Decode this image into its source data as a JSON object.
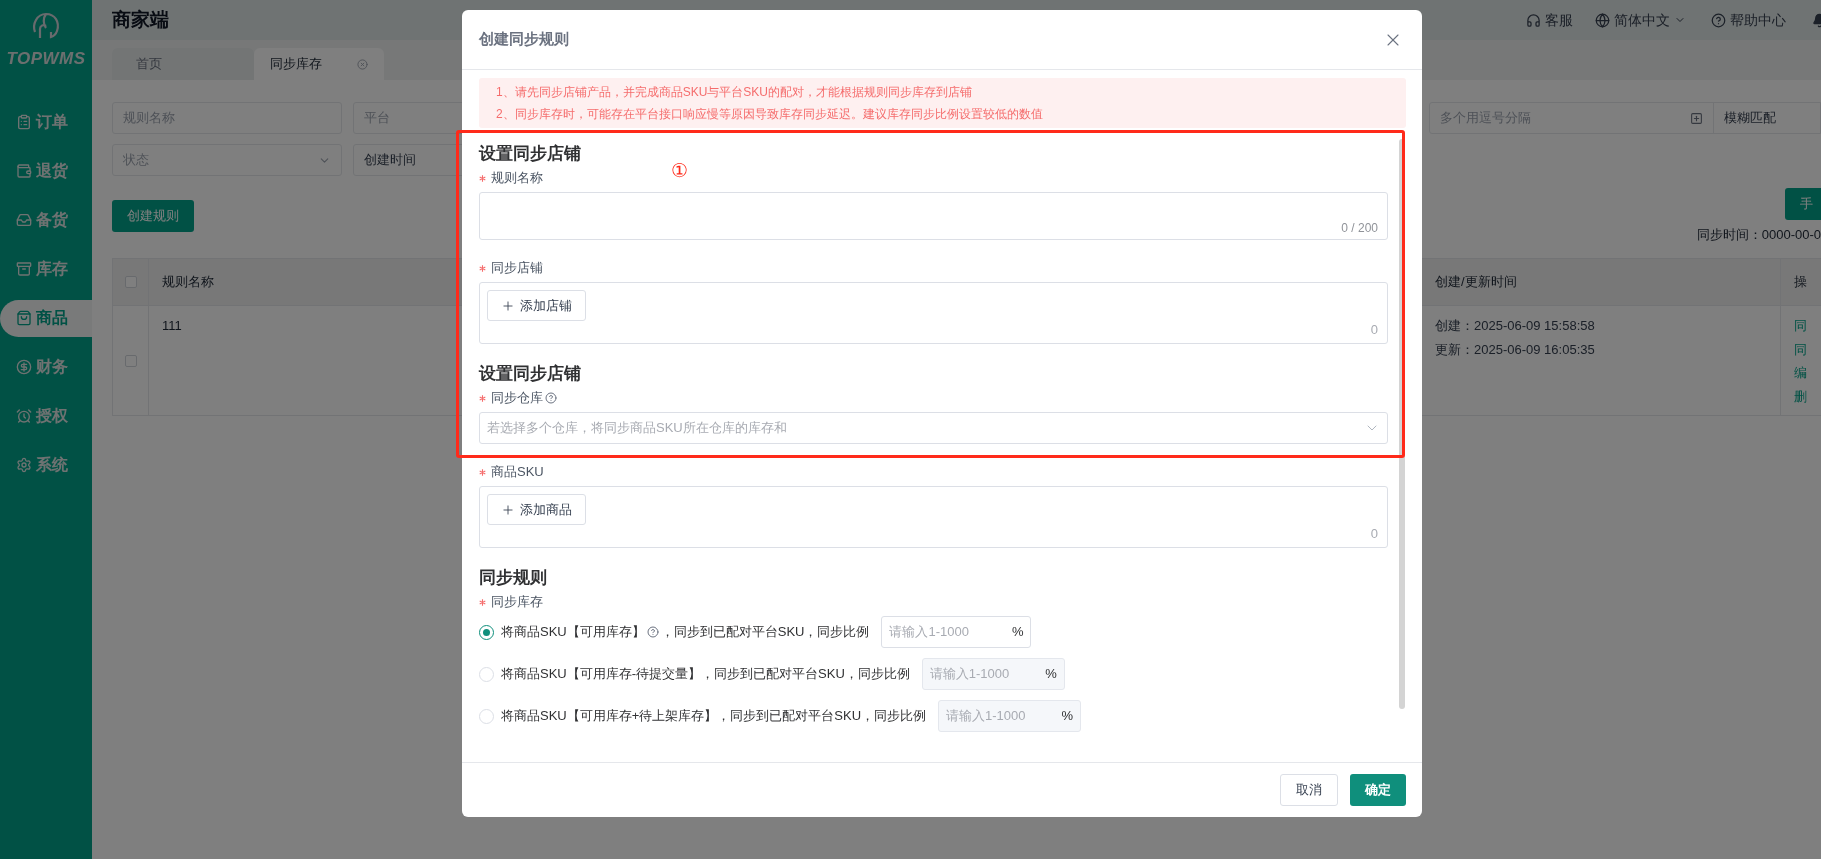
{
  "sidebar": {
    "logo": "TOPWMS",
    "items": [
      {
        "label": "订单",
        "selected": false
      },
      {
        "label": "退货",
        "selected": false
      },
      {
        "label": "备货",
        "selected": false
      },
      {
        "label": "库存",
        "selected": false
      },
      {
        "label": "商品",
        "selected": true
      },
      {
        "label": "财务",
        "selected": false
      },
      {
        "label": "授权",
        "selected": false
      },
      {
        "label": "系统",
        "selected": false
      }
    ]
  },
  "header": {
    "title": "商家端",
    "service": "客服",
    "language": "简体中文",
    "help": "帮助中心"
  },
  "tabs": [
    {
      "label": "首页",
      "selected": false,
      "closable": false
    },
    {
      "label": "同步库存",
      "selected": true,
      "closable": true
    }
  ],
  "filters": {
    "rule_name": {
      "placeholder": "规则名称"
    },
    "platform": {
      "placeholder": "平台"
    },
    "sku": {
      "placeholder": "多个用逗号分隔"
    },
    "match_mode": {
      "value": "模糊匹配"
    },
    "status": {
      "placeholder": "状态"
    },
    "time_type": {
      "value": "创建时间"
    }
  },
  "create_button": "创建规则",
  "manual_button": "手",
  "sync_time": "同步时间：0000-00-0",
  "table": {
    "header_checked": false,
    "columns": [
      "规则名称",
      "创建/更新时间",
      "操"
    ],
    "rows": [
      {
        "selected": false,
        "name": "111",
        "created": "创建：2025-06-09 15:58:58",
        "updated": "更新：2025-06-09 16:05:35",
        "actions": [
          "同",
          "同",
          "编",
          "删"
        ]
      }
    ]
  },
  "dialog": {
    "title": "创建同步规则",
    "notices": [
      "1、请先同步店铺产品，并完成商品SKU与平台SKU的配对，才能根据规则同步库存到店铺",
      "2、同步库存时，可能存在平台接口响应慢等原因导致库存同步延迟。建议库存同步比例设置较低的数值"
    ],
    "sections": [
      {
        "title": "设置同步店铺",
        "fields": [
          {
            "kind": "textarea",
            "label": "规则名称",
            "required": true,
            "counter": "0 / 200"
          },
          {
            "kind": "picker",
            "label": "同步店铺",
            "required": true,
            "button": "添加店铺",
            "count": "0"
          }
        ]
      },
      {
        "title": "设置同步店铺",
        "fields": [
          {
            "kind": "select",
            "label": "同步仓库",
            "required": true,
            "help": true,
            "placeholder": "若选择多个仓库，将同步商品SKU所在仓库的库存和"
          },
          {
            "kind": "picker",
            "label": "商品SKU",
            "required": true,
            "button": "添加商品",
            "count": "0"
          }
        ]
      },
      {
        "title": "同步规则",
        "fields": [
          {
            "kind": "radio",
            "label": "同步库存",
            "required": true,
            "options": [
              {
                "selected": true,
                "label": "将商品SKU【可用库存】",
                "help": true,
                "label_after": "，同步到已配对平台SKU，同步比例",
                "placeholder": "请输入1-1000",
                "unit": "%"
              },
              {
                "selected": false,
                "label": "将商品SKU【可用库存-待提交量】，同步到已配对平台SKU，同步比例",
                "help": false,
                "placeholder": "请输入1-1000",
                "unit": "%"
              },
              {
                "selected": false,
                "label": "将商品SKU【可用库存+待上架库存】，同步到已配对平台SKU，同步比例",
                "help": false,
                "placeholder": "请输入1-1000",
                "unit": "%"
              }
            ]
          }
        ]
      }
    ],
    "cancel": "取消",
    "confirm": "确定"
  },
  "annotation": {
    "marker": "①"
  }
}
